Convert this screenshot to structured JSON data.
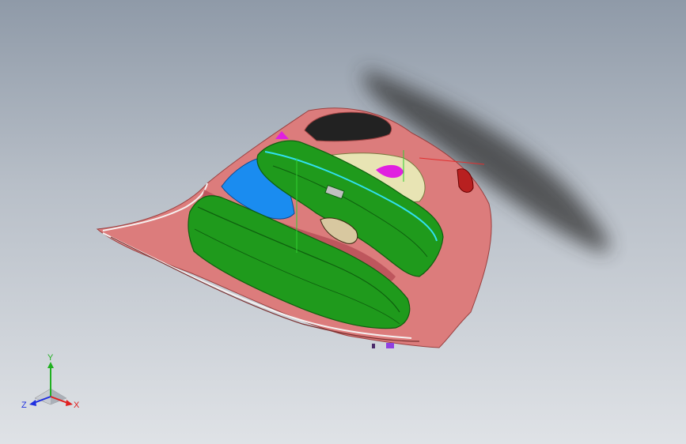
{
  "viewport": {
    "background_top": "#8f9aa8",
    "background_bottom": "#dfe2e6"
  },
  "model": {
    "colors": {
      "shell": "#dc7c7c",
      "shell_edge": "#9a4040",
      "panel_green": "#1f9a1c",
      "panel_green_dark": "#0e5e0e",
      "panel_blue": "#1a8cf0",
      "panel_beige": "#e8e4b4",
      "window_dark": "#222222",
      "highlight_magenta": "#e020e0",
      "accent_cyan": "#30e0f0",
      "tail_light": "#b82020",
      "shadow": "#333333"
    }
  },
  "triad": {
    "x_label": "X",
    "y_label": "Y",
    "z_label": "Z",
    "x_color": "#e02020",
    "y_color": "#20b020",
    "z_color": "#2030e0"
  }
}
